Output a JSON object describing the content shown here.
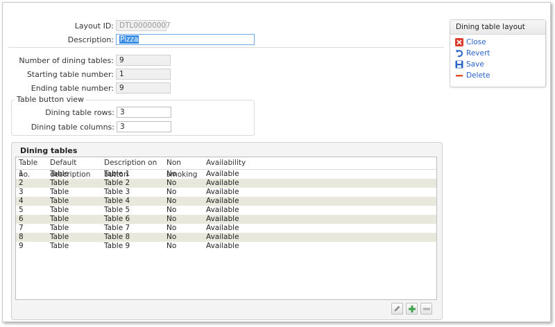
{
  "form": {
    "layout_id_label": "Layout ID:",
    "layout_id_value": "DTL00000007",
    "description_label": "Description:",
    "description_value": "Pizza",
    "num_tables_label": "Number of dining tables:",
    "num_tables_value": "9",
    "start_label": "Starting table number:",
    "start_value": "1",
    "end_label": "Ending table number:",
    "end_value": "9"
  },
  "button_view": {
    "title": "Table button view",
    "rows_label": "Dining table rows:",
    "rows_value": "3",
    "cols_label": "Dining table columns:",
    "cols_value": "3"
  },
  "tables": {
    "title": "Dining tables",
    "columns": [
      "Table no.",
      "Default description",
      "Description on button",
      "Non smoking",
      "Availability"
    ],
    "rows": [
      [
        "1",
        "Table",
        "Table 1",
        "No",
        "Available"
      ],
      [
        "2",
        "Table",
        "Table 2",
        "No",
        "Available"
      ],
      [
        "3",
        "Table",
        "Table 3",
        "No",
        "Available"
      ],
      [
        "4",
        "Table",
        "Table 4",
        "No",
        "Available"
      ],
      [
        "5",
        "Table",
        "Table 5",
        "No",
        "Available"
      ],
      [
        "6",
        "Table",
        "Table 6",
        "No",
        "Available"
      ],
      [
        "7",
        "Table",
        "Table 7",
        "No",
        "Available"
      ],
      [
        "8",
        "Table",
        "Table 8",
        "No",
        "Available"
      ],
      [
        "9",
        "Table",
        "Table 9",
        "No",
        "Available"
      ]
    ],
    "toolbar_icons": [
      "edit-icon",
      "add-icon",
      "remove-icon"
    ]
  },
  "side_panel": {
    "title": "Dining table layout",
    "actions": [
      {
        "label": "Close",
        "icon": "close-icon",
        "color": "#d93a2b"
      },
      {
        "label": "Revert",
        "icon": "revert-icon",
        "color": "#2a63c8"
      },
      {
        "label": "Save",
        "icon": "save-icon",
        "color": "#2a63c8"
      },
      {
        "label": "Delete",
        "icon": "delete-icon",
        "color": "#e0512b"
      }
    ]
  },
  "colors": {
    "link": "#2a63c8",
    "row_alt": "#e8e9dc",
    "selection": "#3a8ee6"
  }
}
